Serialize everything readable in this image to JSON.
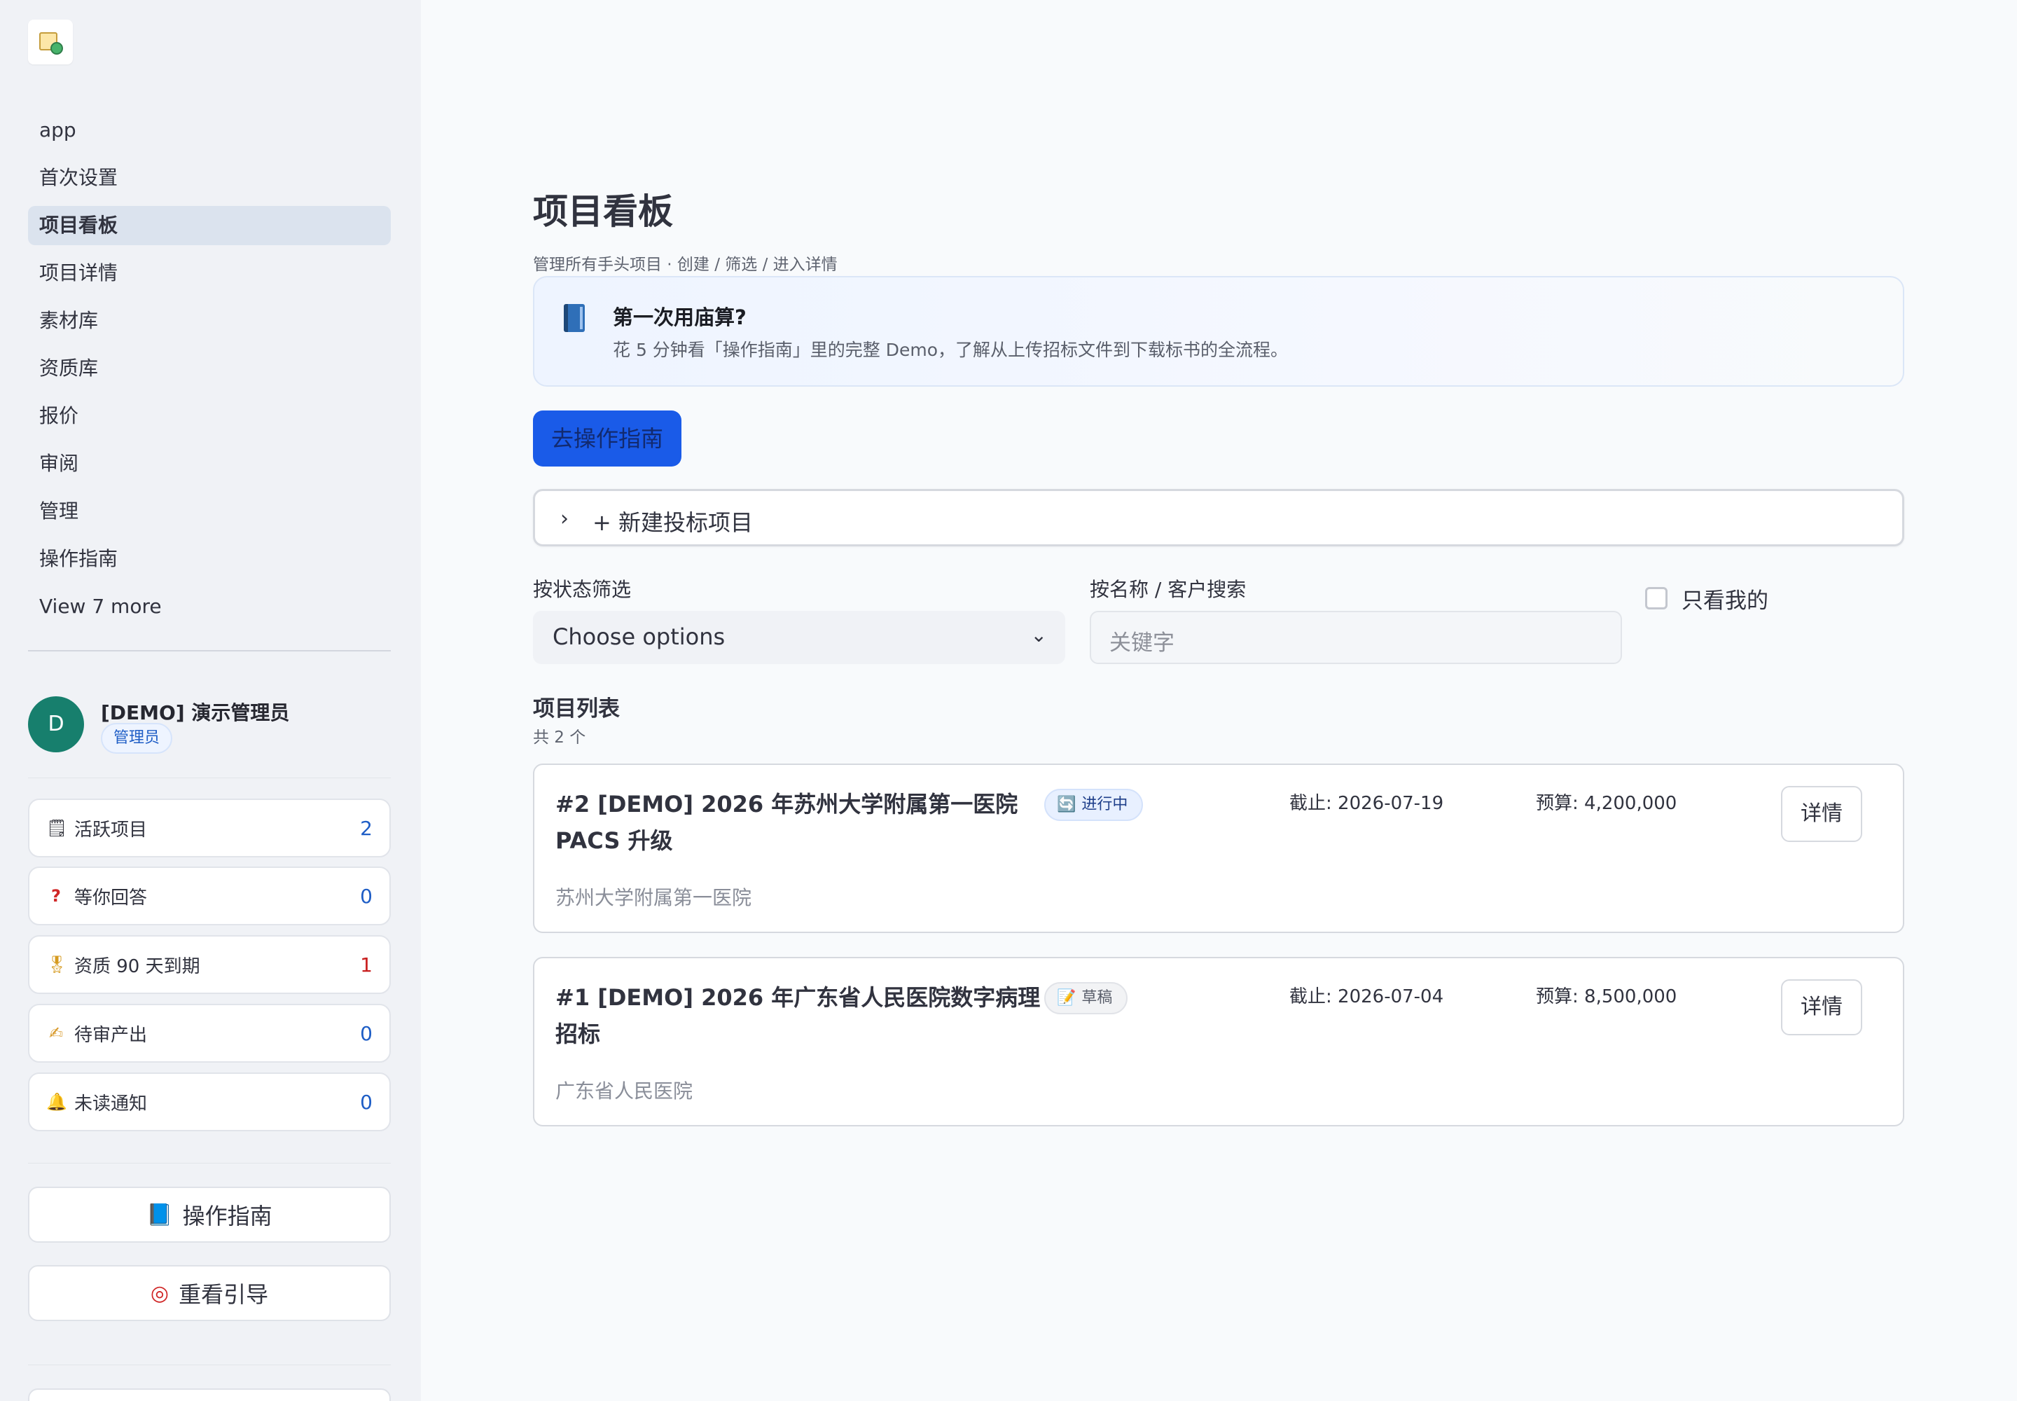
{
  "sidebar": {
    "nav": [
      {
        "label": "app"
      },
      {
        "label": "首次设置"
      },
      {
        "label": "项目看板",
        "active": true
      },
      {
        "label": "项目详情"
      },
      {
        "label": "素材库"
      },
      {
        "label": "资质库"
      },
      {
        "label": "报价"
      },
      {
        "label": "审阅"
      },
      {
        "label": "管理"
      },
      {
        "label": "操作指南"
      }
    ],
    "more_label": "View 7 more",
    "user": {
      "initial": "D",
      "name": "[DEMO] 演示管理员",
      "role": "管理员"
    },
    "stats": [
      {
        "icon": "clipboard-icon",
        "label": "活跃项目",
        "value": "2",
        "color": "#1f5ec6"
      },
      {
        "icon": "question-icon",
        "label": "等你回答",
        "value": "0",
        "color": "#1f5ec6"
      },
      {
        "icon": "medal-icon",
        "label": "资质 90 天到期",
        "value": "1",
        "color": "#c81e1e"
      },
      {
        "icon": "writing-hand-icon",
        "label": "待审产出",
        "value": "0",
        "color": "#1f5ec6"
      },
      {
        "icon": "bell-icon",
        "label": "未读通知",
        "value": "0",
        "color": "#1f5ec6"
      }
    ],
    "buttons": [
      {
        "icon": "book-icon",
        "label": "操作指南"
      },
      {
        "icon": "target-icon",
        "label": "重看引导"
      }
    ]
  },
  "main": {
    "title": "项目看板",
    "subtitle": "管理所有手头项目 · 创建 / 筛选 / 进入详情",
    "callout": {
      "icon": "book-icon",
      "title": "第一次用庙算?",
      "body": "花 5 分钟看「操作指南」里的完整 Demo，了解从上传招标文件到下载标书的全流程。"
    },
    "guide_button": "去操作指南",
    "new_project_expander": "+ 新建投标项目",
    "filters": {
      "status_label": "按状态筛选",
      "status_value": "Choose options",
      "search_label": "按名称 / 客户搜索",
      "search_placeholder": "关键字",
      "mine_only_label": "只看我的",
      "mine_only_checked": false
    },
    "list": {
      "title": "项目列表",
      "count": "共 2 个",
      "projects": [
        {
          "title": "#2 [DEMO] 2026 年苏州大学附属第一医院 PACS 升级",
          "client": "苏州大学附属第一医院",
          "status": "进行中",
          "status_icon": "refresh-icon",
          "due": "截止: 2026-07-19",
          "budget": "预算: 4,200,000",
          "detail_button": "详情"
        },
        {
          "title": "#1 [DEMO] 2026 年广东省人民医院数字病理招标",
          "client": "广东省人民医院",
          "status": "草稿",
          "status_icon": "memo-icon",
          "due": "截止: 2026-07-04",
          "budget": "预算: 8,500,000",
          "detail_button": "详情"
        }
      ]
    }
  },
  "colors": {
    "accent": "#1a5be8",
    "sidebar_bg": "#f0f2f6",
    "page_bg": "#f8fafc",
    "avatar": "#177f6d",
    "danger": "#c81e1e"
  }
}
